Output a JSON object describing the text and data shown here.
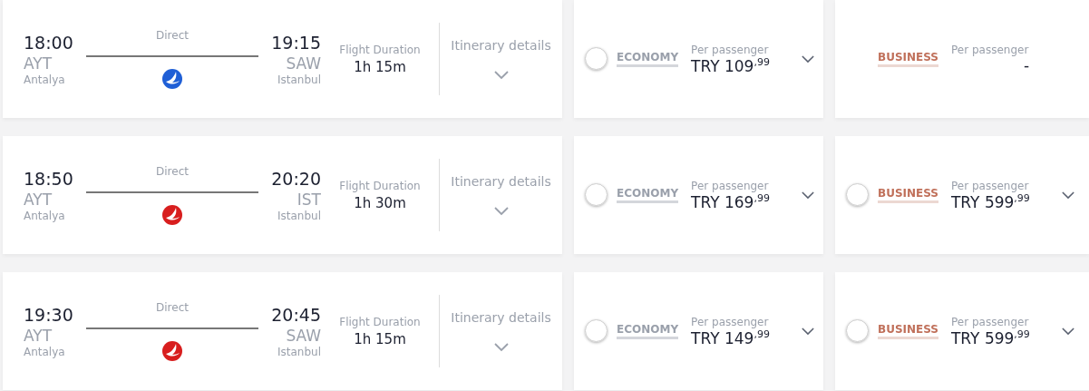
{
  "flights": [
    {
      "depart_time": "18:00",
      "depart_code": "AYT",
      "depart_city": "Antalya",
      "stops": "Direct",
      "color": "#1f5fd6",
      "arrive_time": "19:15",
      "arrive_code": "SAW",
      "arrive_city": "Istanbul",
      "duration_label": "Flight Duration",
      "duration": "1h 15m",
      "details": "Itinerary details",
      "fares": [
        {
          "kind": "economy",
          "class": "ECONOMY",
          "per": "Per passenger",
          "price": "TRY 109$^{,99}$",
          "available": true,
          "selected": false
        },
        {
          "kind": "business",
          "class": "BUSINESS",
          "per": "Per passenger",
          "price": "-",
          "available": false
        }
      ]
    },
    {
      "depart_time": "18:50",
      "depart_code": "AYT",
      "depart_city": "Antalya",
      "stops": "Direct",
      "color": "#d81e1e",
      "arrive_time": "20:20",
      "arrive_code": "IST",
      "arrive_city": "Istanbul",
      "duration_label": "Flight Duration",
      "duration": "1h 30m",
      "details": "Itinerary details",
      "fares": [
        {
          "kind": "economy",
          "class": "ECONOMY",
          "per": "Per passenger",
          "price": "TRY 169$^{,99}$",
          "available": true,
          "selected": false
        },
        {
          "kind": "business",
          "class": "BUSINESS",
          "per": "Per passenger",
          "price": "TRY 599$^{,99}$",
          "available": true,
          "selected": false
        }
      ]
    },
    {
      "depart_time": "19:30",
      "depart_code": "AYT",
      "depart_city": "Antalya",
      "stops": "Direct",
      "color": "#d81e1e",
      "arrive_time": "20:45",
      "arrive_code": "SAW",
      "arrive_city": "Istanbul",
      "duration_label": "Flight Duration",
      "duration": "1h 15m",
      "details": "Itinerary details",
      "fares": [
        {
          "kind": "economy",
          "class": "ECONOMY",
          "per": "Per passenger",
          "price": "TRY 149$^{,99}$",
          "available": true,
          "selected": false
        },
        {
          "kind": "business",
          "class": "BUSINESS",
          "per": "Per passenger",
          "price": "TRY 599$^{,99}$",
          "available": true,
          "selected": false
        }
      ]
    }
  ]
}
